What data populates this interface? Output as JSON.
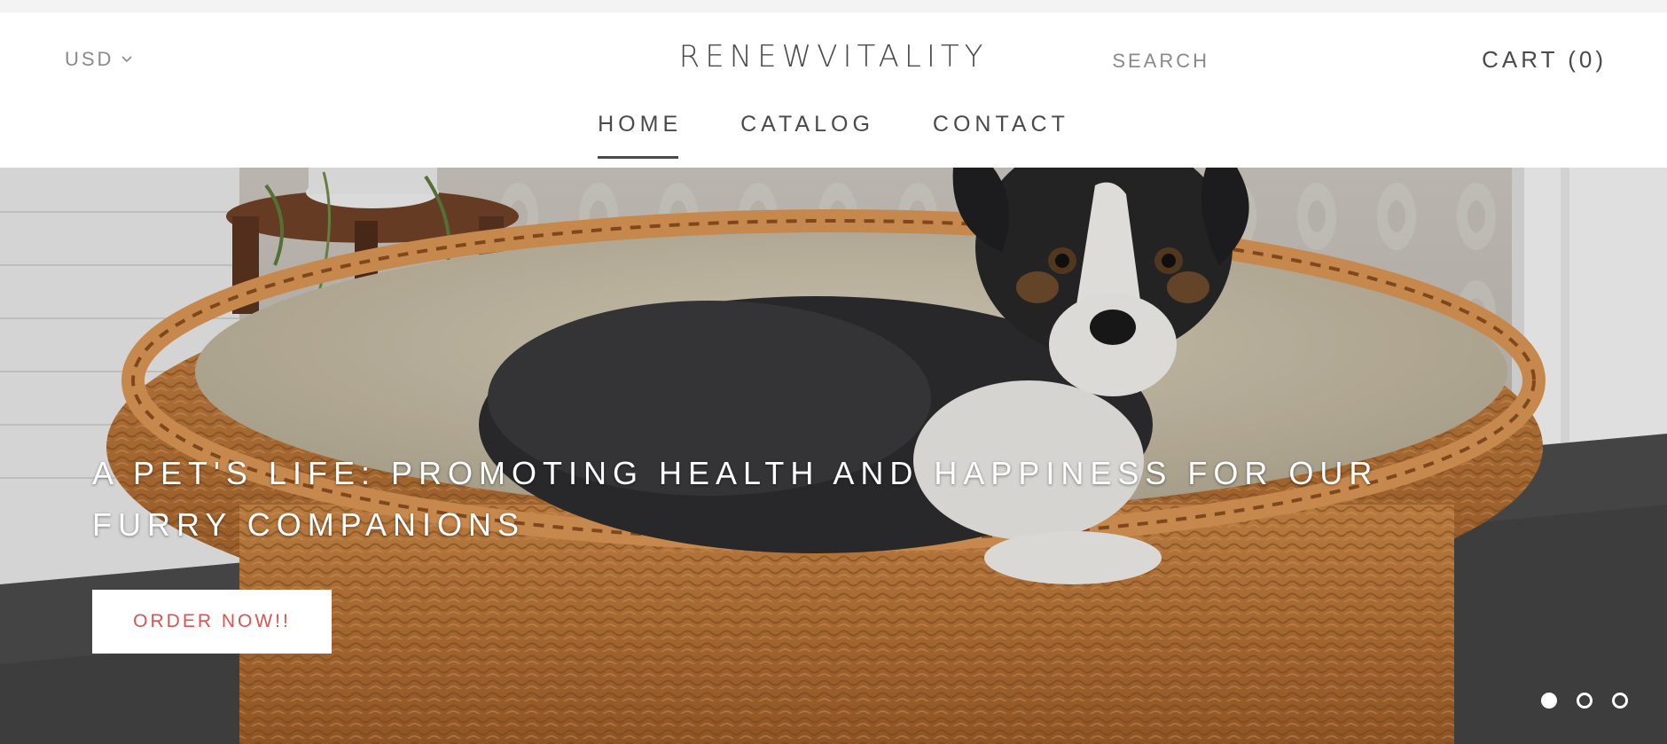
{
  "header": {
    "currency": "USD",
    "brand": "RENEWVITALITY",
    "search_label": "SEARCH",
    "cart_label": "CART (0)"
  },
  "nav": {
    "items": [
      {
        "label": "HOME",
        "active": true
      },
      {
        "label": "CATALOG",
        "active": false
      },
      {
        "label": "CONTACT",
        "active": false
      }
    ]
  },
  "hero": {
    "title": "A PET'S LIFE: PROMOTING HEALTH AND HAPPINESS FOR OUR FURRY COMPANIONS",
    "button_label": "ORDER NOW!!",
    "slides_total": 3,
    "active_slide": 1
  },
  "colors": {
    "accent": "#d9534f",
    "text_dark": "#4a4a4a",
    "text_muted": "#8a8a8a",
    "top_strip": "#f3f3f3"
  },
  "icons": {
    "currency_dropdown": "chevron-down-icon",
    "slide_indicator": "circle-dot-icon"
  }
}
